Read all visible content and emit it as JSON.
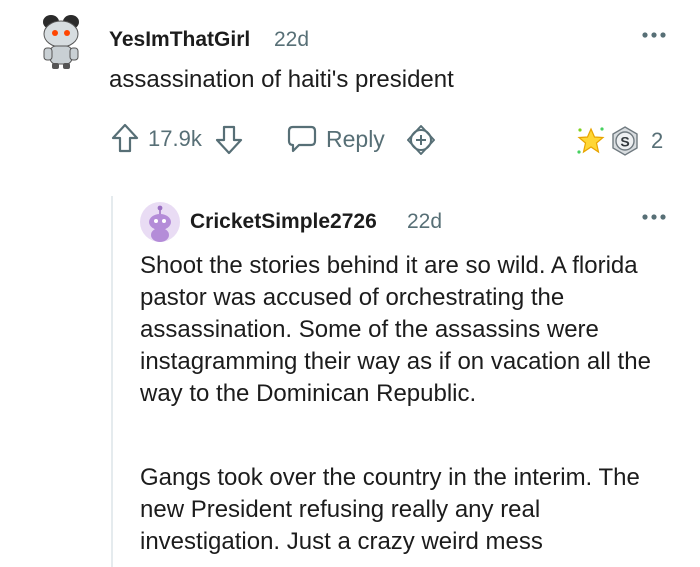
{
  "comment": {
    "username": "YesImThatGirl",
    "age": "22d",
    "body": "assassination of haiti's president",
    "score": "17.9k",
    "reply_label": "Reply",
    "award_count": "2",
    "award_icons": [
      "sparkle-star-award-icon",
      "silver-s-award-icon"
    ]
  },
  "reply": {
    "username": "CricketSimple2726",
    "age": "22d",
    "paragraphs": [
      "Shoot the stories behind it are so wild. A florida pastor was accused of orchestrating the assassination. Some of the assassins were instagramming their way as if on vacation all the way to the Dominican Republic.",
      "Gangs took over the country in the interim. The new President refusing really any real investigation. Just a crazy weird mess"
    ]
  },
  "colors": {
    "text": "#1c1c1c",
    "meta": "#576f76",
    "thread_line": "#e5ebee",
    "avatar_purple": "#b48cd8"
  }
}
